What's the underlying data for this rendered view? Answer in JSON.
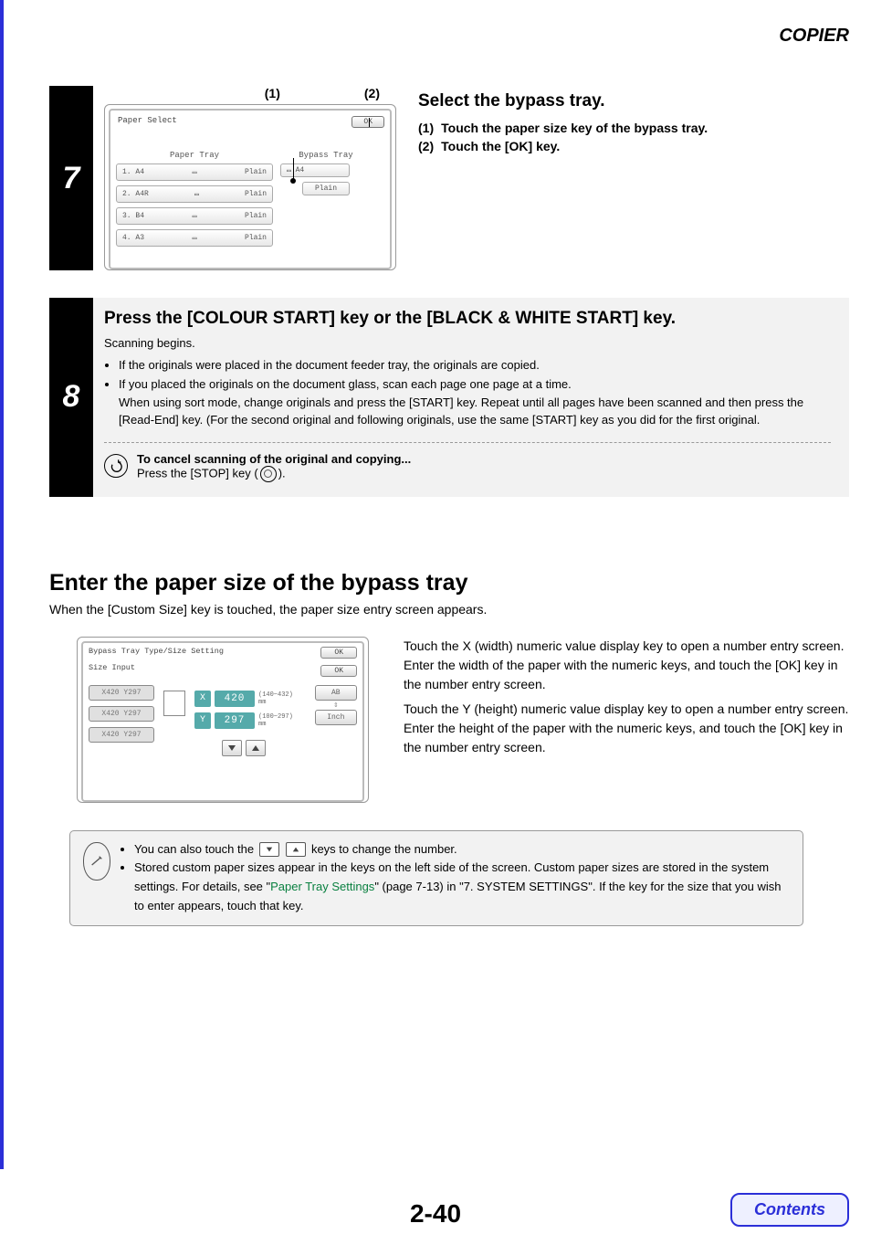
{
  "header": {
    "section": "COPIER"
  },
  "step7": {
    "number": "7",
    "callout1": "(1)",
    "callout2": "(2)",
    "screen": {
      "title": "Paper Select",
      "ok": "OK",
      "paper_tray_label": "Paper Tray",
      "bypass_tray_label": "Bypass Tray",
      "trays": [
        {
          "name": "1. A4",
          "type": "Plain"
        },
        {
          "name": "2. A4R",
          "type": "Plain"
        },
        {
          "name": "3. B4",
          "type": "Plain"
        },
        {
          "name": "4. A3",
          "type": "Plain"
        }
      ],
      "bypass_a4": "A4",
      "bypass_plain": "Plain"
    },
    "heading": "Select the bypass tray.",
    "sub1_num": "(1)",
    "sub1_text": "Touch the paper size key of the bypass tray.",
    "sub2_num": "(2)",
    "sub2_text": "Touch the [OK] key."
  },
  "step8": {
    "number": "8",
    "heading": "Press the [COLOUR START] key or the [BLACK & WHITE START] key.",
    "line1": "Scanning begins.",
    "bullet1": "If the originals were placed in the document feeder tray, the originals are copied.",
    "bullet2": "If you placed the originals on the document glass, scan each page one page at a time.",
    "bullet2b": "When using sort mode, change originals and press the [START] key. Repeat until all pages have been scanned and then press the [Read-End] key. (For the second original and following originals, use the same [START] key as you did for the first original.",
    "cancel_heading": "To cancel scanning of the original and copying...",
    "cancel_text_a": "Press the [STOP] key (",
    "cancel_text_b": ")."
  },
  "section": {
    "heading": "Enter the paper size of the bypass tray",
    "desc": "When the [Custom Size] key is touched, the paper size entry screen appears."
  },
  "screenB": {
    "title": "Bypass Tray Type/Size Setting",
    "subtitle": "Size Input",
    "ok": "OK",
    "presets": [
      "X420 Y297",
      "X420 Y297",
      "X420 Y297"
    ],
    "x_label": "X",
    "x_val": "420",
    "x_range": "(140~432)",
    "y_label": "Y",
    "y_val": "297",
    "y_range": "(100~297)",
    "mm": "mm",
    "unit1": "AB",
    "unit2": "Inch",
    "unit_arrow": "⇕"
  },
  "desc": {
    "p1": "Touch the X (width) numeric value display key to open a number entry screen. Enter the width of the paper with the numeric keys, and touch the [OK] key in the number entry screen.",
    "p2": "Touch the Y (height) numeric value display key to open a number entry screen. Enter the height of the paper with the numeric keys, and touch the [OK] key in the number entry screen."
  },
  "info": {
    "b1a": "You can also touch the ",
    "b1b": " keys to change the number.",
    "b2a": "Stored custom paper sizes appear in the keys on the left side of the screen. Custom paper sizes are stored in the system settings. For details, see \"",
    "b2link": "Paper Tray Settings",
    "b2b": "\" (page 7-13) in \"7. SYSTEM SETTINGS\". If the key for the size that you wish to enter appears, touch that key."
  },
  "footer": {
    "page": "2-40",
    "contents": "Contents"
  }
}
